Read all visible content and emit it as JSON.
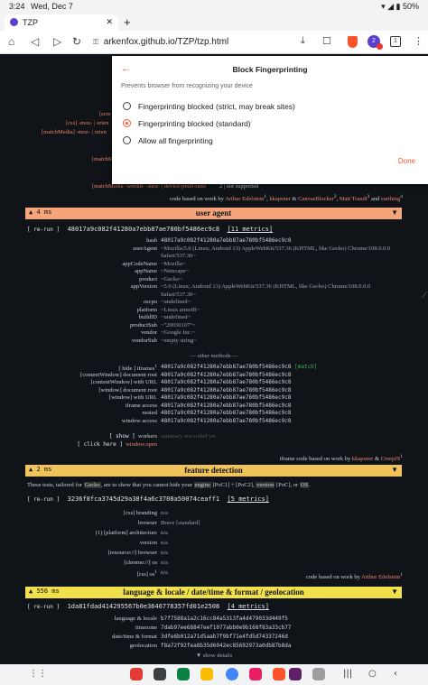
{
  "status": {
    "time": "3:24",
    "date": "Wed, Dec 7",
    "battery": "50%"
  },
  "tab": {
    "title": "TZP",
    "close": "✕",
    "new": "+"
  },
  "url": {
    "text": "arkenfox.github.io/TZP/tzp.html",
    "tab_count": "1",
    "ext_badge": "2"
  },
  "popup": {
    "back": "←",
    "title": "Block Fingerprinting",
    "description": "Prevents browser from recognizing your device",
    "options": [
      {
        "label": "Fingerprinting blocked (strict, may break sites)",
        "selected": false
      },
      {
        "label": "Fingerprinting blocked (standard)",
        "selected": true
      },
      {
        "label": "Allow all fingerprinting",
        "selected": false
      }
    ],
    "done": "Done"
  },
  "behind": {
    "l1": "[scre",
    "l2": "[css] -moz- | orien",
    "l3": "[matchMedia] -moz- | orien",
    "l4": "[matchM",
    "l5": "[matchMedia -webkit- -moz- | device-pixel-ratio",
    "l5v": "2 | not supported"
  },
  "credit_top": {
    "prefix": "code based on work by",
    "a1": "Arthur Edelstein",
    "s1": "1",
    "mid1": ", ",
    "a2": "kkapsner",
    "mid2": " & ",
    "a3": "CanvasBlocker",
    "s3": "2",
    "mid3": ", ",
    "a4": "Matt Traudt",
    "s4": "3",
    "mid4": " and ",
    "a5": "earthing",
    "s5": "4"
  },
  "ua": {
    "section": {
      "time": "4 ms",
      "title": "user agent",
      "arrow": "▼"
    },
    "rerun": "[ re-run ]",
    "hash": "48017a9c082f41280a7ebb87ae780bf5486ec9c8",
    "metrics": "[11 metrics]",
    "rows": [
      {
        "k": "hash",
        "v": "48017a9c082f41280a7ebb87ae780bf5486ec9c8",
        "mono": true
      },
      {
        "k": "userAgent",
        "v": "~Mozilla/5.0 (Linux; Android 13) AppleWebKit/537.36 (KHTML, like Gecko) Chrome/108.0.0.0"
      },
      {
        "k": "",
        "v": "Safari/537.36~"
      },
      {
        "k": "appCodeName",
        "v": "~Mozilla~"
      },
      {
        "k": "appName",
        "v": "~Netscape~"
      },
      {
        "k": "product",
        "v": "~Gecko~"
      },
      {
        "k": "appVersion",
        "v": "~5.0 (Linux; Android 13) AppleWebKit/537.36 (KHTML, like Gecko) Chrome/108.0.0.0"
      },
      {
        "k": "",
        "v": "Safari/537.36~"
      },
      {
        "k": "oscpu",
        "v": "~undefined~"
      },
      {
        "k": "platform",
        "v": "~Linux armv8l~"
      },
      {
        "k": "buildID",
        "v": "~undefined~"
      },
      {
        "k": "productSub",
        "v": "~\"20030107\"~"
      },
      {
        "k": "vendor",
        "v": "~Google Inc.~"
      },
      {
        "k": "vendorSub",
        "v": "~empty string~"
      }
    ],
    "other_methods": "— other methods —",
    "rows2": [
      {
        "k": "[ hide ]  iframes",
        "sup": "1",
        "v": "48017a9c082f41280a7ebb87ae780bf5486ec9c8",
        "extra": "[match]"
      },
      {
        "k": "[contentWindow] document root",
        "v": "48017a9c082f41280a7ebb87ae780bf5486ec9c8"
      },
      {
        "k": "[contentWindow] with URL",
        "v": "48017a9c082f41280a7ebb87ae780bf5486ec9c8"
      },
      {
        "k": "[window] document root",
        "v": "48017a9c082f41280a7ebb87ae780bf5486ec9c8"
      },
      {
        "k": "[window] with URL",
        "v": "48017a9c082f41280a7ebb87ae780bf5486ec9c8"
      },
      {
        "k": "iframe access",
        "v": "48017a9c082f41280a7ebb87ae780bf5486ec9c8"
      },
      {
        "k": "nested",
        "v": "48017a9c082f41280a7ebb87ae780bf5486ec9c8"
      },
      {
        "k": "window access",
        "v": "48017a9c082f41280a7ebb87ae780bf5486ec9c8"
      }
    ],
    "workers": {
      "btn": "[ show ]",
      "k": "workers",
      "v": "summary not coded yet"
    },
    "open": {
      "btn": "[ click here ]",
      "k": "window.open"
    },
    "credit": {
      "prefix": "iframe code based on work by",
      "a1": "kkapsner",
      "mid": " & ",
      "a2": "CreepJS",
      "sup": "1"
    }
  },
  "fd": {
    "section": {
      "time": "2 ms",
      "title": "feature detection",
      "arrow": "▼"
    },
    "intro": {
      "p1": "These tests, tailored for ",
      "gecko": "Gecko",
      "p2": ", are to show that you cannot hide your ",
      "engine": "engine",
      "p3": " [PoC1] + [PoC2], ",
      "version": "version",
      "p4": " [PoC], or ",
      "os": "OS",
      "p5": "."
    },
    "rerun": "[ re-run ]",
    "hash": "3236f8fca3745d29a38f4a6c3708a50074ceaff1",
    "metrics": "[5 metrics]",
    "rows": [
      {
        "k": "[css] branding",
        "v": "n/a"
      },
      {
        "k": "browser",
        "v": "Brave [standard]"
      },
      {
        "k": "(1)  [platform] architecture",
        "v": "n/a"
      },
      {
        "k": "version",
        "v": "n/a"
      },
      {
        "k": "[resource://] browser",
        "v": "n/a"
      },
      {
        "k": "[chrome://] os",
        "v": "n/a"
      },
      {
        "k": "[css] os",
        "sup": "1",
        "v": "n/a"
      }
    ],
    "credit": {
      "prefix": "code based on work by",
      "a1": "Arthur Edelstein",
      "sup": "1"
    }
  },
  "lang": {
    "section": {
      "time": "556 ms",
      "title": "language & locale / date/time & format / geolocation",
      "arrow": "▼"
    },
    "rerun": "[ re-run ]",
    "hash": "1da81fdad414295567b0e3646778357fd01e2508",
    "metrics": "[4 metrics]",
    "rows": [
      {
        "k": "language & locale",
        "v": "b7f7588a1a2c16cc84a5313fa4d479033d449f5"
      },
      {
        "k": "timezone",
        "v": "7dab97ee68847eef1077abb0e9b168f83a33cb77"
      },
      {
        "k": "date/time & format",
        "v": "3dfe6b012a71d5aab7f9bf71e4fd5d74337246d"
      },
      {
        "k": "geolocation",
        "v": "f8a72f92fea8b35d6042ec85692973a0db87b8da"
      }
    ],
    "show_details": "▼ show details"
  }
}
